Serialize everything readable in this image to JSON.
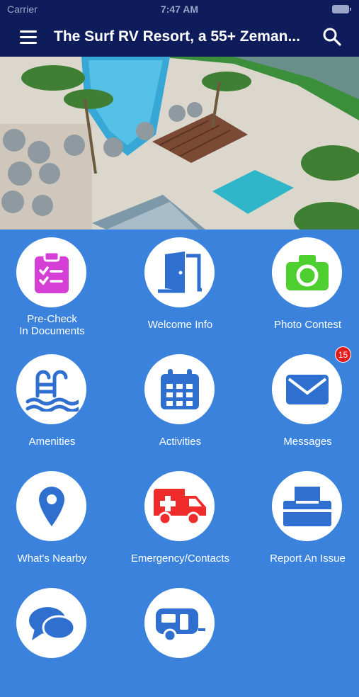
{
  "status_bar": {
    "carrier": "Carrier",
    "time": "7:47 AM"
  },
  "nav": {
    "title": "The Surf RV Resort, a 55+ Zeman..."
  },
  "tiles": [
    {
      "label": "Pre-Check\nIn Documents",
      "icon": "clipboard-checklist-icon"
    },
    {
      "label": "Welcome Info",
      "icon": "open-door-icon"
    },
    {
      "label": "Photo Contest",
      "icon": "camera-icon"
    },
    {
      "label": "Amenities",
      "icon": "pool-ladder-icon"
    },
    {
      "label": "Activities",
      "icon": "calendar-icon"
    },
    {
      "label": "Messages",
      "icon": "envelope-icon",
      "badge": "15"
    },
    {
      "label": "What's Nearby",
      "icon": "map-pin-icon"
    },
    {
      "label": "Emergency/Contacts",
      "icon": "ambulance-icon"
    },
    {
      "label": "Report An Issue",
      "icon": "printer-icon"
    },
    {
      "label": "",
      "icon": "chat-bubbles-icon"
    },
    {
      "label": "",
      "icon": "rv-trailer-icon"
    }
  ],
  "colors": {
    "navbar": "#0f1c5c",
    "background": "#3b82dc",
    "icon_blue": "#2f6fd0",
    "badge": "#e41b1b",
    "magenta": "#d63fd6",
    "green": "#4ccf2f",
    "red": "#f02b2b"
  }
}
